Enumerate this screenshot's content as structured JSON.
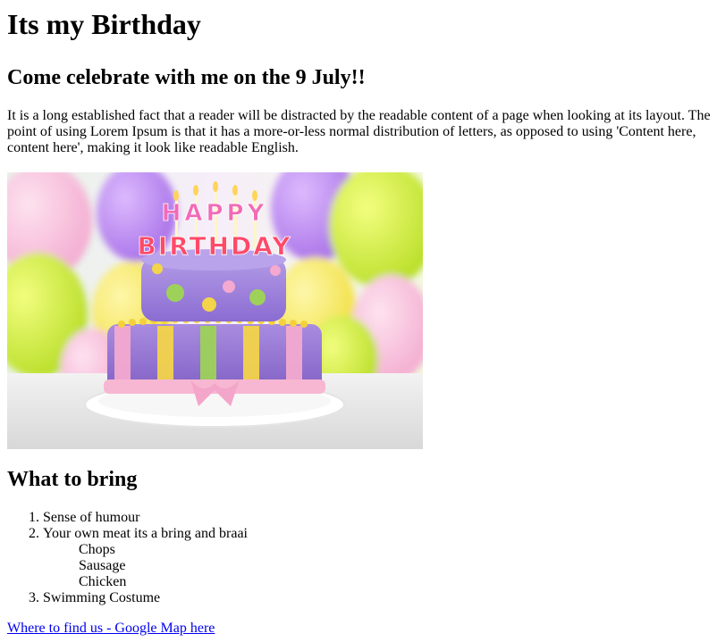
{
  "page": {
    "title": "Its my Birthday",
    "subtitle": "Come celebrate with me on the 9 July!!",
    "intro": "It is a long established fact that a reader will be distracted by the readable content of a page when looking at its layout. The point of using Lorem Ipsum is that it has a more-or-less normal distribution of letters, as opposed to using 'Content here, content here', making it look like readable English."
  },
  "image": {
    "cake_topper_line1": "HAPPY",
    "cake_topper_line2": "BIRTHDAY"
  },
  "bring": {
    "heading": "What to bring",
    "items": [
      "Sense of humour",
      "Your own meat its a bring and braai",
      "Swimming Costume"
    ],
    "meats": [
      "Chops",
      "Sausage",
      "Chicken"
    ]
  },
  "map": {
    "link_text": "Where to find us - Google Map here"
  },
  "colors": {
    "link": "#0000ee"
  }
}
